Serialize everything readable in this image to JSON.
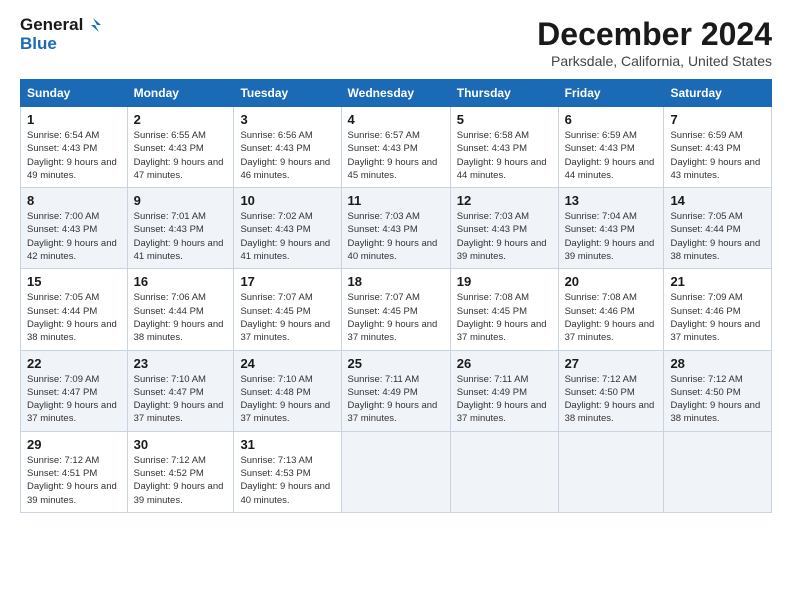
{
  "header": {
    "logo_line1": "General",
    "logo_line2": "Blue",
    "title": "December 2024",
    "subtitle": "Parksdale, California, United States"
  },
  "columns": [
    "Sunday",
    "Monday",
    "Tuesday",
    "Wednesday",
    "Thursday",
    "Friday",
    "Saturday"
  ],
  "weeks": [
    [
      {
        "day": "1",
        "sunrise": "6:54 AM",
        "sunset": "4:43 PM",
        "daylight": "9 hours and 49 minutes."
      },
      {
        "day": "2",
        "sunrise": "6:55 AM",
        "sunset": "4:43 PM",
        "daylight": "9 hours and 47 minutes."
      },
      {
        "day": "3",
        "sunrise": "6:56 AM",
        "sunset": "4:43 PM",
        "daylight": "9 hours and 46 minutes."
      },
      {
        "day": "4",
        "sunrise": "6:57 AM",
        "sunset": "4:43 PM",
        "daylight": "9 hours and 45 minutes."
      },
      {
        "day": "5",
        "sunrise": "6:58 AM",
        "sunset": "4:43 PM",
        "daylight": "9 hours and 44 minutes."
      },
      {
        "day": "6",
        "sunrise": "6:59 AM",
        "sunset": "4:43 PM",
        "daylight": "9 hours and 44 minutes."
      },
      {
        "day": "7",
        "sunrise": "6:59 AM",
        "sunset": "4:43 PM",
        "daylight": "9 hours and 43 minutes."
      }
    ],
    [
      {
        "day": "8",
        "sunrise": "7:00 AM",
        "sunset": "4:43 PM",
        "daylight": "9 hours and 42 minutes."
      },
      {
        "day": "9",
        "sunrise": "7:01 AM",
        "sunset": "4:43 PM",
        "daylight": "9 hours and 41 minutes."
      },
      {
        "day": "10",
        "sunrise": "7:02 AM",
        "sunset": "4:43 PM",
        "daylight": "9 hours and 41 minutes."
      },
      {
        "day": "11",
        "sunrise": "7:03 AM",
        "sunset": "4:43 PM",
        "daylight": "9 hours and 40 minutes."
      },
      {
        "day": "12",
        "sunrise": "7:03 AM",
        "sunset": "4:43 PM",
        "daylight": "9 hours and 39 minutes."
      },
      {
        "day": "13",
        "sunrise": "7:04 AM",
        "sunset": "4:43 PM",
        "daylight": "9 hours and 39 minutes."
      },
      {
        "day": "14",
        "sunrise": "7:05 AM",
        "sunset": "4:44 PM",
        "daylight": "9 hours and 38 minutes."
      }
    ],
    [
      {
        "day": "15",
        "sunrise": "7:05 AM",
        "sunset": "4:44 PM",
        "daylight": "9 hours and 38 minutes."
      },
      {
        "day": "16",
        "sunrise": "7:06 AM",
        "sunset": "4:44 PM",
        "daylight": "9 hours and 38 minutes."
      },
      {
        "day": "17",
        "sunrise": "7:07 AM",
        "sunset": "4:45 PM",
        "daylight": "9 hours and 37 minutes."
      },
      {
        "day": "18",
        "sunrise": "7:07 AM",
        "sunset": "4:45 PM",
        "daylight": "9 hours and 37 minutes."
      },
      {
        "day": "19",
        "sunrise": "7:08 AM",
        "sunset": "4:45 PM",
        "daylight": "9 hours and 37 minutes."
      },
      {
        "day": "20",
        "sunrise": "7:08 AM",
        "sunset": "4:46 PM",
        "daylight": "9 hours and 37 minutes."
      },
      {
        "day": "21",
        "sunrise": "7:09 AM",
        "sunset": "4:46 PM",
        "daylight": "9 hours and 37 minutes."
      }
    ],
    [
      {
        "day": "22",
        "sunrise": "7:09 AM",
        "sunset": "4:47 PM",
        "daylight": "9 hours and 37 minutes."
      },
      {
        "day": "23",
        "sunrise": "7:10 AM",
        "sunset": "4:47 PM",
        "daylight": "9 hours and 37 minutes."
      },
      {
        "day": "24",
        "sunrise": "7:10 AM",
        "sunset": "4:48 PM",
        "daylight": "9 hours and 37 minutes."
      },
      {
        "day": "25",
        "sunrise": "7:11 AM",
        "sunset": "4:49 PM",
        "daylight": "9 hours and 37 minutes."
      },
      {
        "day": "26",
        "sunrise": "7:11 AM",
        "sunset": "4:49 PM",
        "daylight": "9 hours and 37 minutes."
      },
      {
        "day": "27",
        "sunrise": "7:12 AM",
        "sunset": "4:50 PM",
        "daylight": "9 hours and 38 minutes."
      },
      {
        "day": "28",
        "sunrise": "7:12 AM",
        "sunset": "4:50 PM",
        "daylight": "9 hours and 38 minutes."
      }
    ],
    [
      {
        "day": "29",
        "sunrise": "7:12 AM",
        "sunset": "4:51 PM",
        "daylight": "9 hours and 39 minutes."
      },
      {
        "day": "30",
        "sunrise": "7:12 AM",
        "sunset": "4:52 PM",
        "daylight": "9 hours and 39 minutes."
      },
      {
        "day": "31",
        "sunrise": "7:13 AM",
        "sunset": "4:53 PM",
        "daylight": "9 hours and 40 minutes."
      },
      null,
      null,
      null,
      null
    ]
  ]
}
